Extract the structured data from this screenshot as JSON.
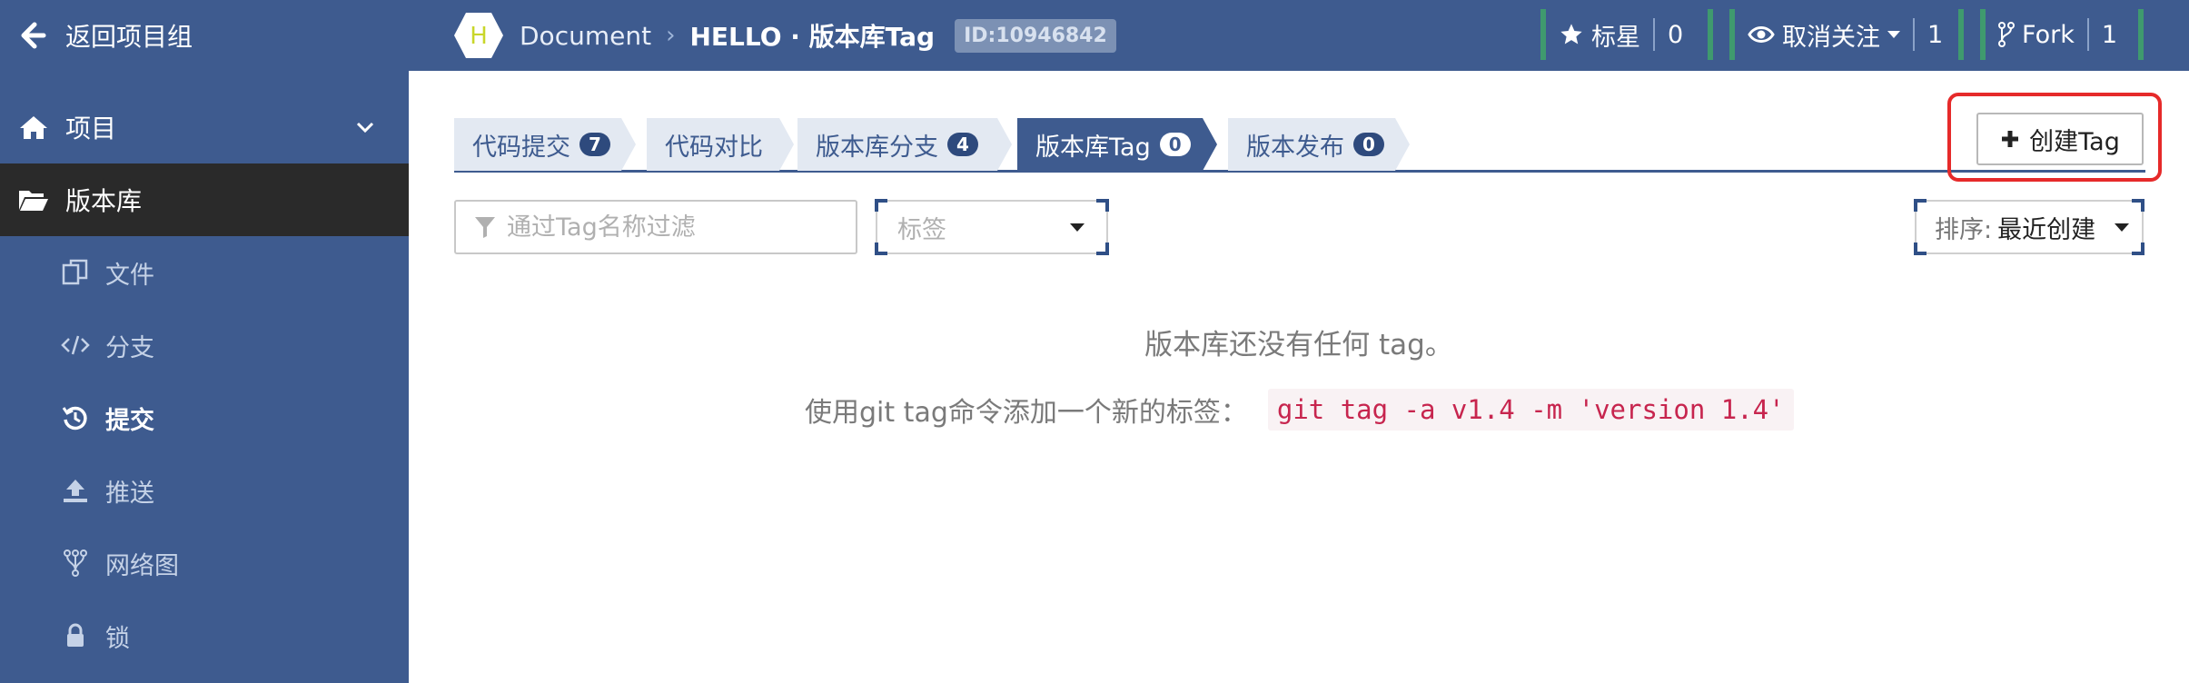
{
  "header": {
    "back_label": "返回项目组",
    "project_initial": "H",
    "breadcrumb_group": "Document",
    "breadcrumb_repo": "HELLO · 版本库Tag",
    "repo_id": "ID:10946842",
    "star": {
      "label": "标星",
      "count": "0"
    },
    "watch": {
      "label": "取消关注",
      "count": "1"
    },
    "fork": {
      "label": "Fork",
      "count": "1"
    }
  },
  "sidebar": {
    "project_label": "项目",
    "repo_label": "版本库",
    "items": [
      {
        "label": "文件",
        "icon": "files-icon"
      },
      {
        "label": "分支",
        "icon": "code-icon"
      },
      {
        "label": "提交",
        "icon": "history-icon"
      },
      {
        "label": "推送",
        "icon": "upload-icon"
      },
      {
        "label": "网络图",
        "icon": "network-icon"
      },
      {
        "label": "锁",
        "icon": "lock-icon"
      }
    ]
  },
  "tabs": [
    {
      "label": "代码提交",
      "badge": "7"
    },
    {
      "label": "代码对比",
      "badge": ""
    },
    {
      "label": "版本库分支",
      "badge": "4"
    },
    {
      "label": "版本库Tag",
      "badge": "0"
    },
    {
      "label": "版本发布",
      "badge": "0"
    }
  ],
  "create_button": "创建Tag",
  "filter_placeholder": "通过Tag名称过滤",
  "tag_select": "标签",
  "sort": {
    "key": "排序:",
    "value": "最近创建"
  },
  "empty": {
    "message": "版本库还没有任何 tag。",
    "hint": "使用git tag命令添加一个新的标签：",
    "command": "git tag -a v1.4 -m 'version 1.4'"
  },
  "colors": {
    "primary": "#3e5b8f",
    "sidebar_active": "#2a2a2a",
    "highlight_box": "#e62a2a",
    "code_text": "#c7254e"
  }
}
